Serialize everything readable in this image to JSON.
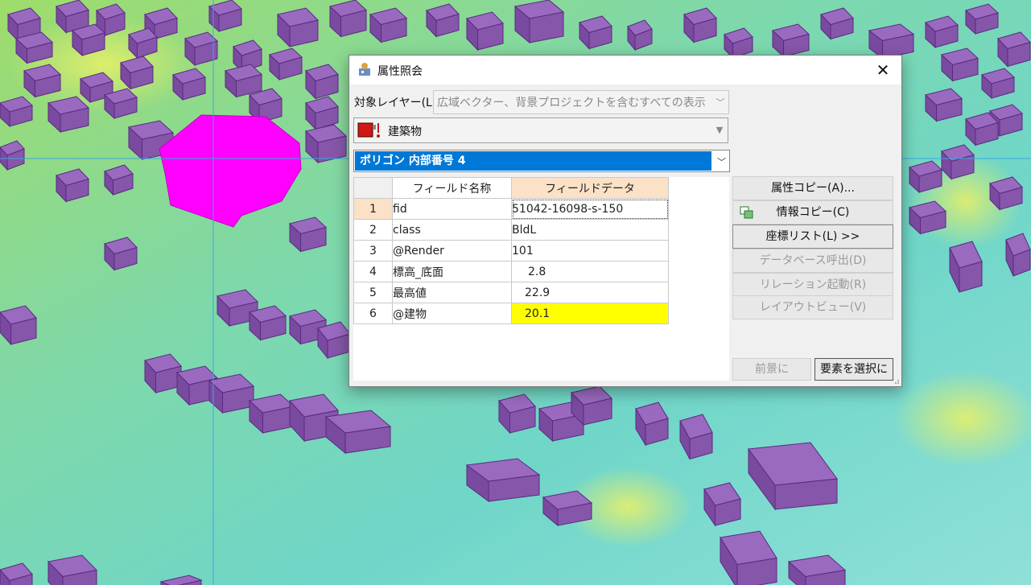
{
  "dialog": {
    "title": "属性照会",
    "close_glyph": "✕",
    "layer_label": "対象レイヤー(L)",
    "layer_combo_value": "広域ベクター、背景プロジェクトを含むすべての表示",
    "feature_combo_value": "建築物",
    "selection_value": "ポリゴン 内部番号 4",
    "table": {
      "headers": [
        "フィールド名称",
        "フィールドデータ"
      ],
      "rows": [
        {
          "num": "1",
          "name": "fid",
          "value": "51042-16098-s-150"
        },
        {
          "num": "2",
          "name": "class",
          "value": "BldL"
        },
        {
          "num": "3",
          "name": "@Render",
          "value": "101"
        },
        {
          "num": "4",
          "name": "標高_底面",
          "value": "2.8"
        },
        {
          "num": "5",
          "name": "最高値",
          "value": "22.9"
        },
        {
          "num": "6",
          "name": "@建物",
          "value": "20.1"
        }
      ]
    },
    "buttons": {
      "attr_copy": "属性コピー(A)...",
      "info_copy": "情報コピー(C)",
      "coord_list": "座標リスト(L) >>",
      "db_call": "データベース呼出(D)",
      "relation": "リレーション起動(R)",
      "layout_view": "レイアウトビュー(V)",
      "foreground": "前景に",
      "select_element": "要素を選択に"
    }
  },
  "colors": {
    "selected_building": "#ff00ff",
    "building": "#8a5ab0",
    "highlight_value": "#ffff00",
    "selection_blue": "#0078d7",
    "header_peach": "#fbe1c6"
  }
}
